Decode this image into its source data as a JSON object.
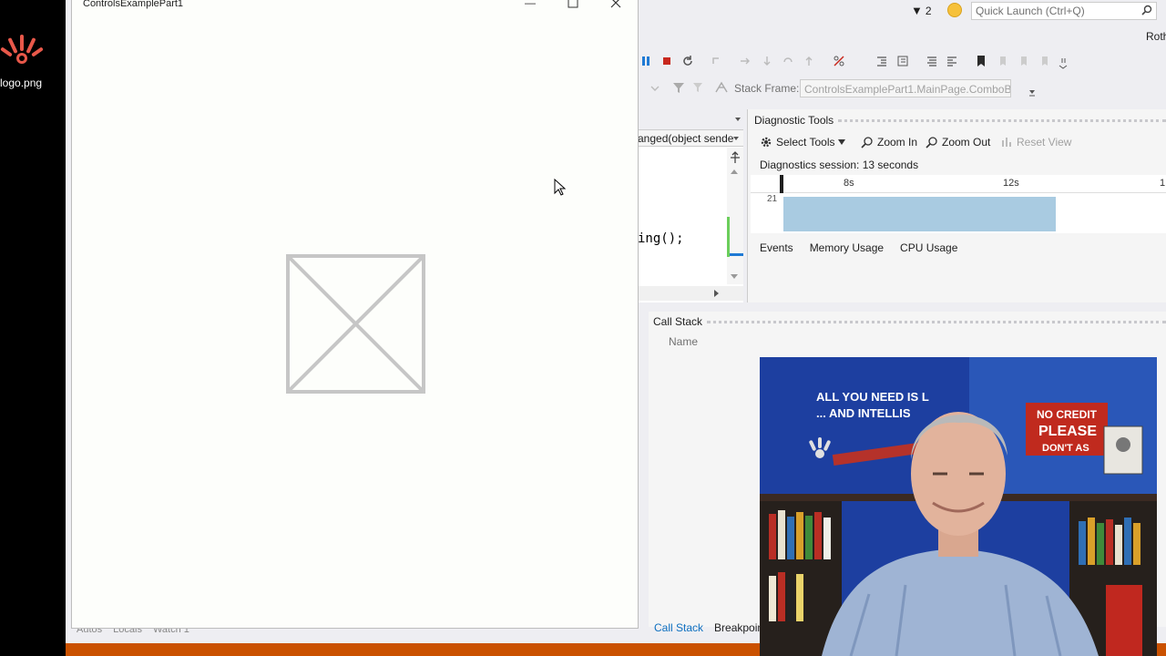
{
  "desktop": {
    "icon_label": "logo.png"
  },
  "app_window": {
    "title": "ControlsExamplePart1"
  },
  "top_bar": {
    "notification_count": "2",
    "quick_launch_placeholder": "Quick Launch (Ctrl+Q)",
    "user_name": "Roth"
  },
  "debug_toolbar": {
    "stack_frame_label": "Stack Frame:",
    "stack_frame_value": "ControlsExamplePart1.MainPage.ComboB"
  },
  "code_editor": {
    "member_dropdown": "anged(object sende",
    "visible_code": "ing();"
  },
  "diagnostic_tools": {
    "title": "Diagnostic Tools",
    "select_tools": "Select Tools",
    "zoom_in": "Zoom In",
    "zoom_out": "Zoom Out",
    "reset_view": "Reset View",
    "session": "Diagnostics session: 13 seconds",
    "ruler_labels": [
      "8s",
      "12s",
      "1"
    ],
    "track_value": "21",
    "tabs": [
      "Events",
      "Memory Usage",
      "CPU Usage"
    ]
  },
  "call_stack": {
    "title": "Call Stack",
    "column_name": "Name",
    "bottom_tabs": [
      "Call Stack",
      "Breakpoin"
    ]
  },
  "left_bottom_tabs": [
    "Autos",
    "Locals",
    "Watch 1"
  ],
  "webcam": {
    "poster_text_1": "ALL YOU NEED IS L",
    "poster_text_2": "... AND INTELLIS",
    "sign_text_1": "NO CREDIT",
    "sign_text_2": "PLEASE",
    "sign_text_3": "DON'T AS"
  },
  "colors": {
    "vs_status": "#ca5100",
    "accent_blue": "#0e70c0",
    "cpu_band": "#a9cbe1"
  }
}
